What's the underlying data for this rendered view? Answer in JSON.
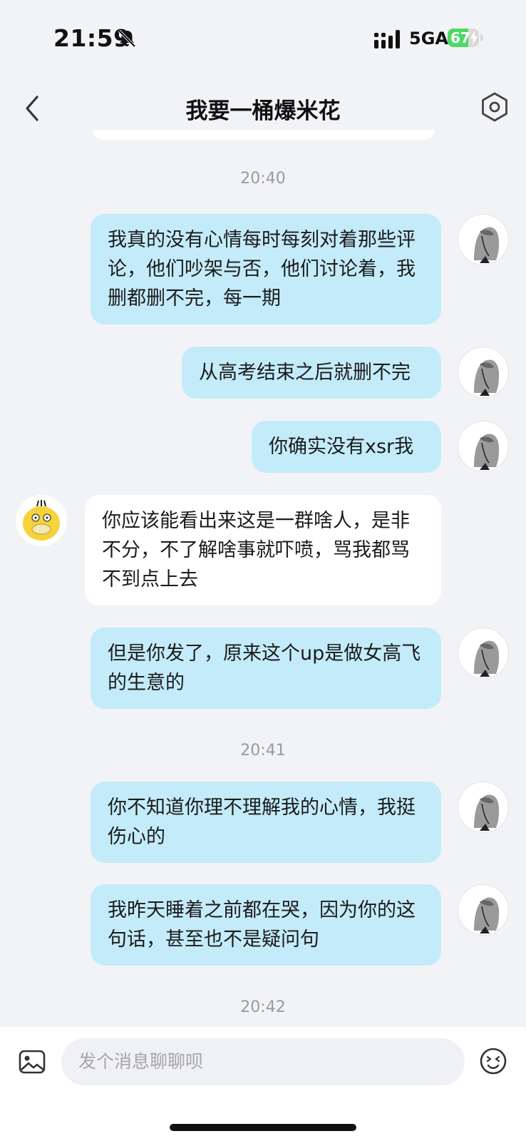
{
  "status_bar": {
    "time": "21:59",
    "network": "5GA",
    "battery_level": "67",
    "battery_fraction": 0.67,
    "icons": [
      "bell-slash-icon",
      "signal-icon",
      "battery-charging-icon"
    ]
  },
  "header": {
    "title": "我要一桶爆米花",
    "icons": [
      "back-chevron-icon",
      "settings-icon"
    ]
  },
  "chat": {
    "timestamps": [
      "20:40",
      "20:41",
      "20:42"
    ],
    "messages": [
      {
        "sender": "me",
        "text": "我真的没有心情每时每刻对着那些评论，他们吵架与否，他们讨论着，我删都删不完，每一期"
      },
      {
        "sender": "me",
        "text": "从高考结束之后就删不完"
      },
      {
        "sender": "me",
        "text": "你确实没有xsr我"
      },
      {
        "sender": "them",
        "text": "你应该能看出来这是一群啥人，是非不分，不了解啥事就吓喷，骂我都骂不到点上去"
      },
      {
        "sender": "me",
        "text": "但是你发了，原来这个up是做女高飞的生意的"
      },
      {
        "sender": "me",
        "text": "你不知道你理不理解我的心情，我挺伤心的"
      },
      {
        "sender": "me",
        "text": "我昨天睡着之前都在哭，因为你的这句话，甚至也不是疑问句"
      }
    ]
  },
  "input_bar": {
    "placeholder": "发个消息聊聊呗",
    "icons": [
      "image-icon",
      "emoji-icon"
    ]
  },
  "colors": {
    "my_bubble": "#c4ebfa",
    "their_bubble": "#ffffff",
    "background": "#f2f3f7",
    "battery_green": "#4cd964"
  }
}
